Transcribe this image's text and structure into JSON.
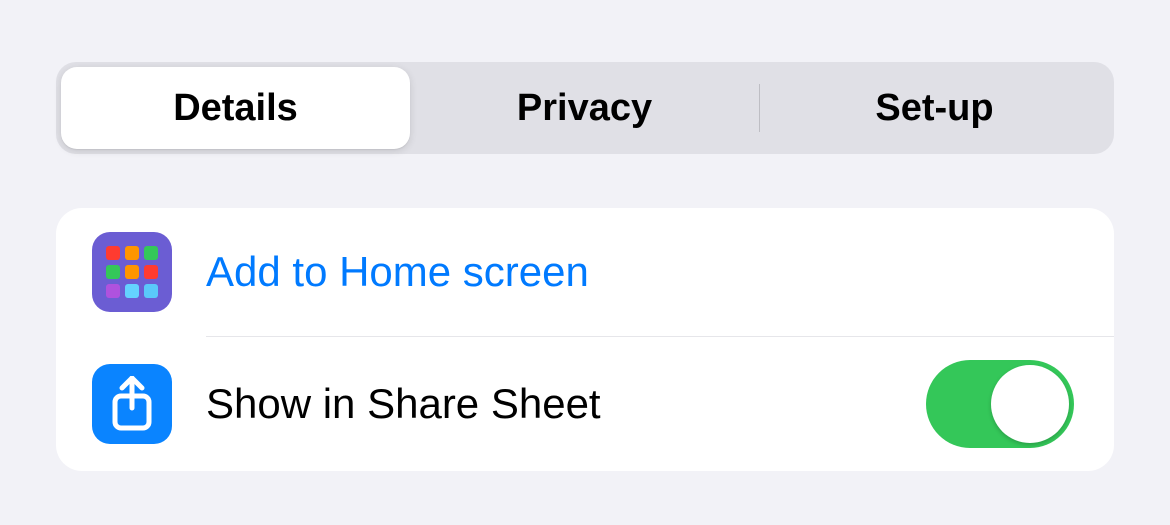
{
  "tabs": {
    "items": [
      {
        "label": "Details",
        "selected": true
      },
      {
        "label": "Privacy",
        "selected": false
      },
      {
        "label": "Set-up",
        "selected": false
      }
    ]
  },
  "rows": {
    "add_home": {
      "label": "Add to Home screen"
    },
    "share_sheet": {
      "label": "Show in Share Sheet",
      "toggle_on": true
    }
  }
}
